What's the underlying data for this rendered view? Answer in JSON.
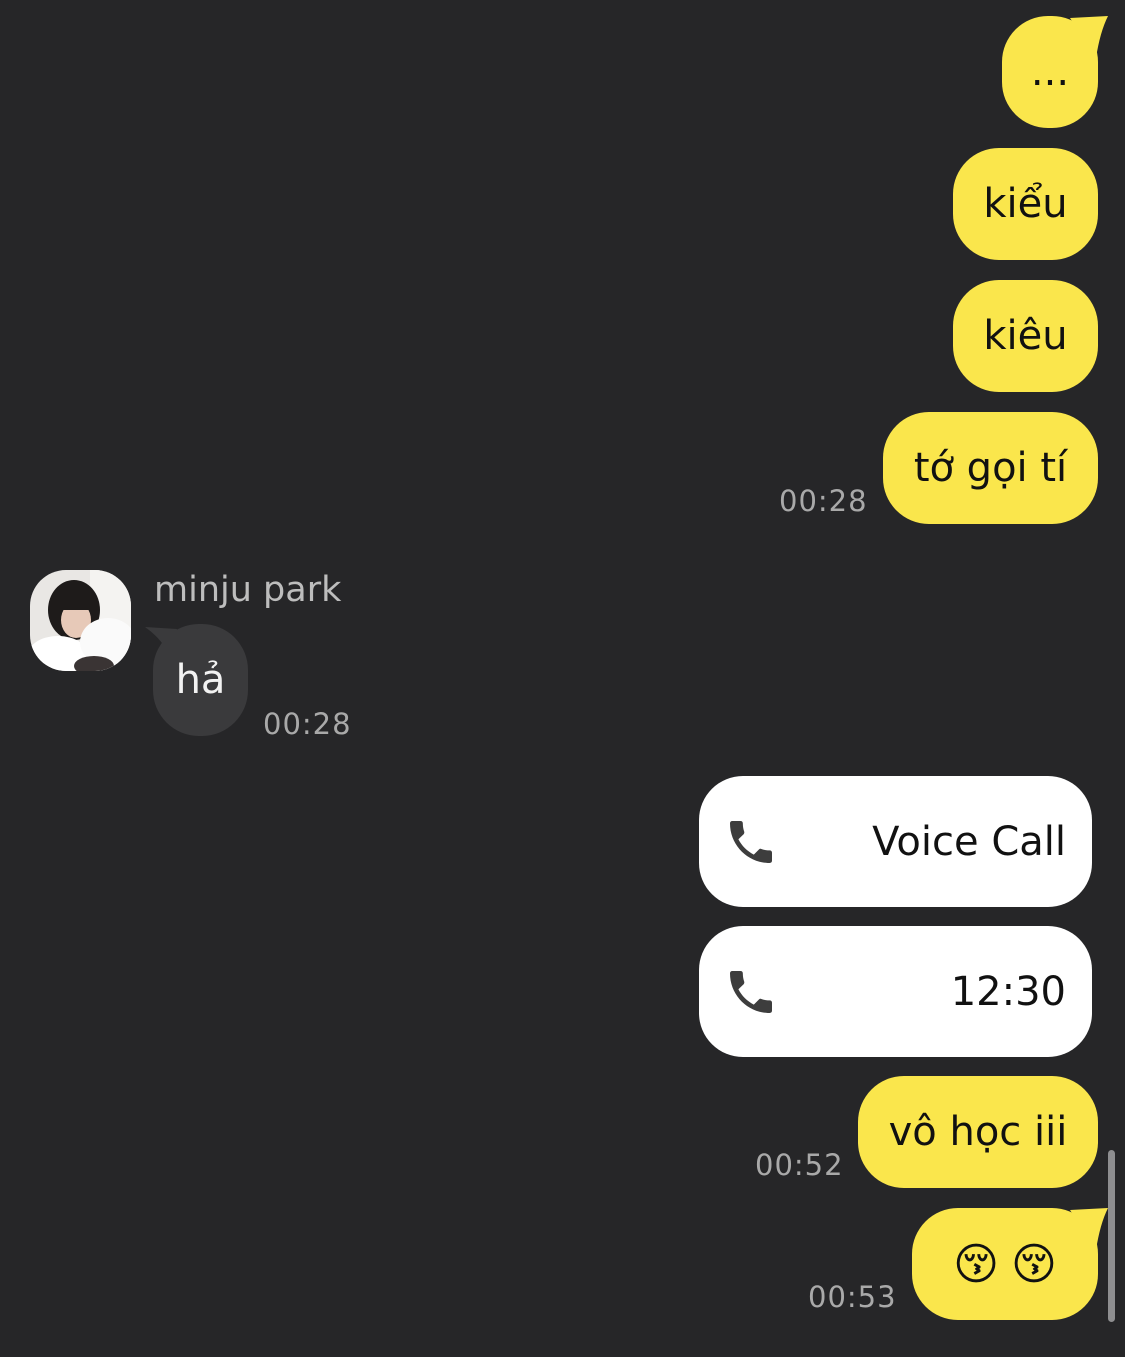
{
  "messages": {
    "m1": "...",
    "m2": "kiểu",
    "m3": "kiêu",
    "m4": "tớ gọi tí",
    "m4_time": "00:28",
    "reply": "hả",
    "reply_time": "00:28",
    "m7": "vô học iii",
    "m7_time": "00:52",
    "m8_emoji_1": "😚",
    "m8_emoji_2": "😚",
    "m8_time": "00:53"
  },
  "contact": {
    "name": "minju park"
  },
  "calls": {
    "call1_label": "Voice Call",
    "call1_icon": "phone-icon",
    "call2_label": "12:30",
    "call2_icon": "phone-icon"
  },
  "colors": {
    "background": "#262628",
    "my_bubble": "#FAE64C",
    "their_bubble": "#3A3A3C",
    "call_card": "#FFFFFF",
    "time_text": "#A9A9A9"
  }
}
